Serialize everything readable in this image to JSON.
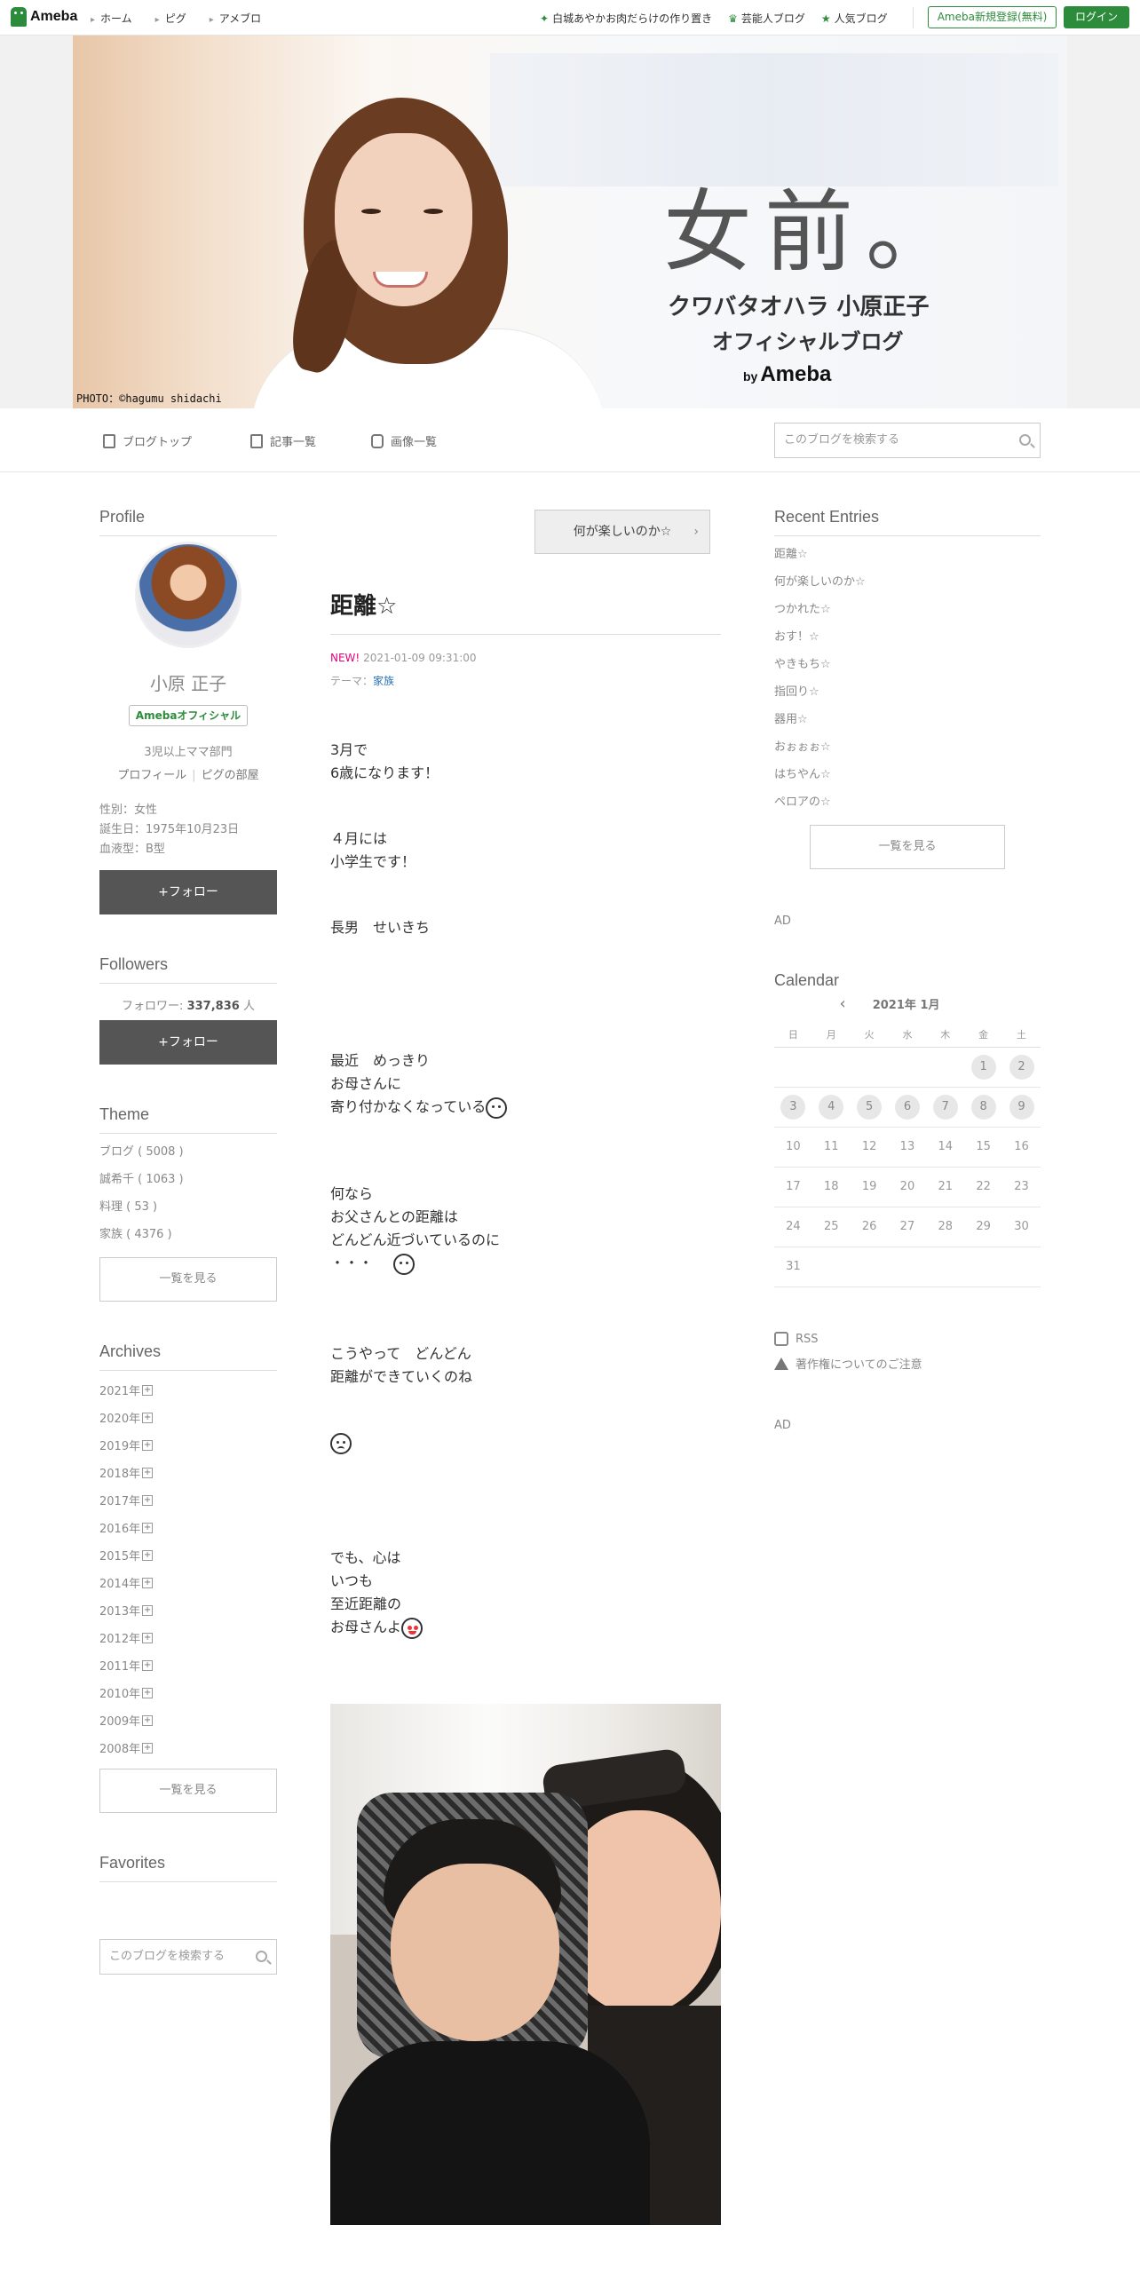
{
  "topbar": {
    "logo": "Ameba",
    "nav": [
      "ホーム",
      "ピグ",
      "アメブロ"
    ],
    "links": [
      "白城あやかお肉だらけの作り置き",
      "芸能人ブログ",
      "人気ブログ"
    ],
    "register": "Ameba新規登録(無料)",
    "login": "ログイン"
  },
  "banner": {
    "title": "女前。",
    "subtitle1": "クワバタオハラ 小原正子",
    "subtitle2": "オフィシャルブログ",
    "by": "by",
    "brand": "Ameba",
    "credit": "PHOTO：©hagumu shidachi"
  },
  "blognav": {
    "items": [
      "ブログトップ",
      "記事一覧",
      "画像一覧"
    ],
    "search_placeholder": "このブログを検索する"
  },
  "profile": {
    "heading": "Profile",
    "name": "小原 正子",
    "badge": "Amebaオフィシャル",
    "desc": "3児以上ママ部門",
    "link1": "プロフィール",
    "link2": "ピグの部屋",
    "gender": "性別：女性",
    "birthday": "誕生日：1975年10月23日",
    "blood": "血液型：B型",
    "follow": "+フォロー"
  },
  "followers": {
    "heading": "Followers",
    "label": "フォロワー:",
    "count": "337,836",
    "unit": "人",
    "follow": "+フォロー"
  },
  "theme": {
    "heading": "Theme",
    "items": [
      "ブログ ( 5008 )",
      "誠希千 ( 1063 )",
      "料理 ( 53 )",
      "家族 ( 4376 )"
    ],
    "more": "一覧を見る"
  },
  "archives": {
    "heading": "Archives",
    "items": [
      "2021年",
      "2020年",
      "2019年",
      "2018年",
      "2017年",
      "2016年",
      "2015年",
      "2014年",
      "2013年",
      "2012年",
      "2011年",
      "2010年",
      "2009年",
      "2008年"
    ],
    "more": "一覧を見る"
  },
  "favorites": {
    "heading": "Favorites",
    "search_placeholder": "このブログを検索する"
  },
  "article": {
    "prev": "何が楽しいのか☆",
    "title": "距離☆",
    "new": "NEW!",
    "date": "2021-01-09 09:31:00",
    "theme_label": "テーマ：",
    "theme": "家族",
    "p1": [
      "3月で",
      "6歳になります！"
    ],
    "p2": [
      "４月には",
      "小学生です！"
    ],
    "p3": [
      "長男　せいきち"
    ],
    "p4": [
      "最近　めっきり",
      "お母さんに",
      "寄り付かなくなっている"
    ],
    "p5": [
      "何なら",
      "お父さんとの距離は",
      "どんどん近づいているのに",
      "・・・"
    ],
    "p6": [
      "こうやって　どんどん",
      "距離ができていくのね"
    ],
    "p7": [
      "でも、心は",
      "いつも",
      "至近距離の",
      "お母さんよ"
    ]
  },
  "recent": {
    "heading": "Recent Entries",
    "items": [
      "距離☆",
      "何が楽しいのか☆",
      "つかれた☆",
      "おす！☆",
      "やきもち☆",
      "指回り☆",
      "器用☆",
      "おぉぉぉ☆",
      "はちやん☆",
      "ペロアの☆"
    ],
    "more": "一覧を見る"
  },
  "ads": {
    "ad1": "AD",
    "ad2": "AD"
  },
  "calendar": {
    "heading": "Calendar",
    "month": "2021年 1月",
    "weekdays": [
      "日",
      "月",
      "火",
      "水",
      "木",
      "金",
      "土"
    ],
    "weeks": [
      [
        "",
        "",
        "",
        "",
        "",
        "1",
        "2"
      ],
      [
        "3",
        "4",
        "5",
        "6",
        "7",
        "8",
        "9"
      ],
      [
        "10",
        "11",
        "12",
        "13",
        "14",
        "15",
        "16"
      ],
      [
        "17",
        "18",
        "19",
        "20",
        "21",
        "22",
        "23"
      ],
      [
        "24",
        "25",
        "26",
        "27",
        "28",
        "29",
        "30"
      ],
      [
        "31",
        "",
        "",
        "",
        "",
        "",
        ""
      ]
    ],
    "posted_days": [
      "1",
      "2",
      "3",
      "4",
      "5",
      "6",
      "7",
      "8",
      "9"
    ]
  },
  "footer_links": {
    "rss": "RSS",
    "copyright": "著作権についてのご注意"
  },
  "colors": {
    "accent": "#2d8c3c",
    "follow_btn": "#555555",
    "new_label": "#e4007f",
    "link": "#2a72b5"
  }
}
